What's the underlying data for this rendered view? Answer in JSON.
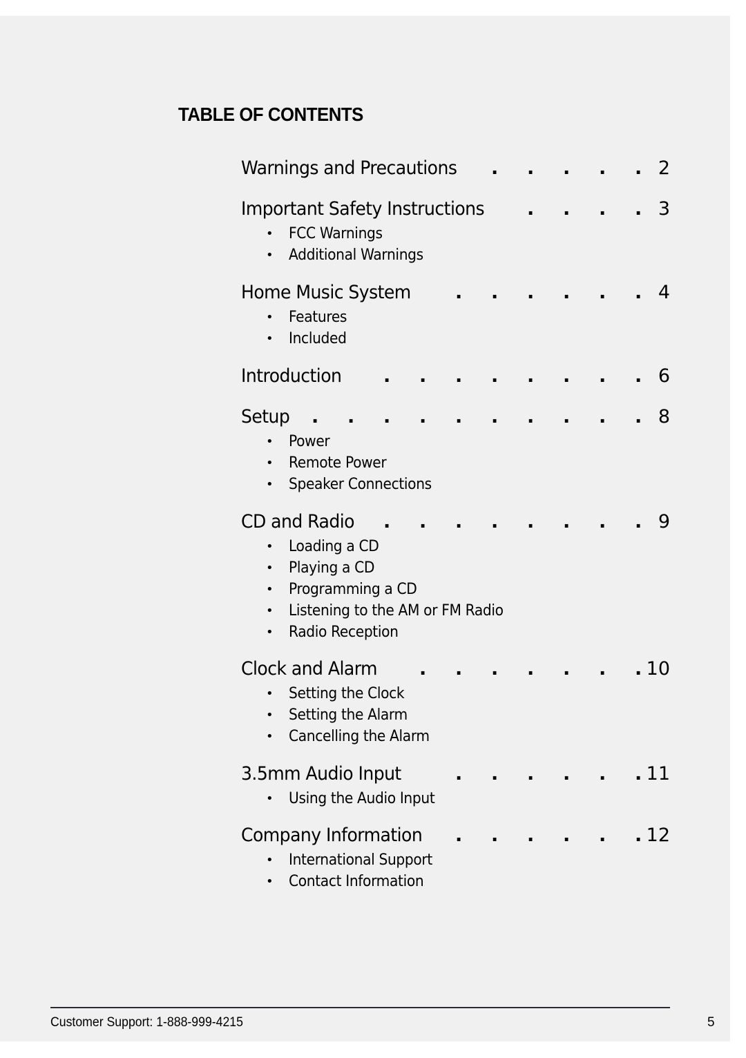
{
  "toc": {
    "title": "TABLE OF CONTENTS",
    "entries": [
      {
        "heading": "Warnings and Precautions",
        "page": "2",
        "subitems": []
      },
      {
        "heading": "Important Safety Instructions",
        "page": "3",
        "subitems": [
          "FCC Warnings",
          "Additional Warnings"
        ]
      },
      {
        "heading": "Home Music System",
        "page": "4",
        "subitems": [
          "Features",
          "Included"
        ]
      },
      {
        "heading": "Introduction",
        "page": "6",
        "subitems": []
      },
      {
        "heading": "Setup",
        "page": "8",
        "subitems": [
          "Power",
          "Remote Power",
          "Speaker Connections"
        ]
      },
      {
        "heading": "CD and Radio",
        "page": "9",
        "subitems": [
          "Loading a CD",
          "Playing a CD",
          "Programming a CD",
          "Listening to the AM or FM Radio",
          "Radio Reception"
        ]
      },
      {
        "heading": "Clock and Alarm",
        "page": "10",
        "subitems": [
          "Setting the Clock",
          "Setting the Alarm",
          "Cancelling the Alarm"
        ]
      },
      {
        "heading": "3.5mm Audio Input",
        "page": "11",
        "subitems": [
          "Using the Audio Input"
        ]
      },
      {
        "heading": "Company Information",
        "page": "12",
        "subitems": [
          "International Support",
          "Contact Information"
        ]
      }
    ],
    "leader_char": ".",
    "bullet_char": "•"
  },
  "footer": {
    "support_text": "Customer Support: 1-888-999-4215",
    "page_number": "5"
  }
}
